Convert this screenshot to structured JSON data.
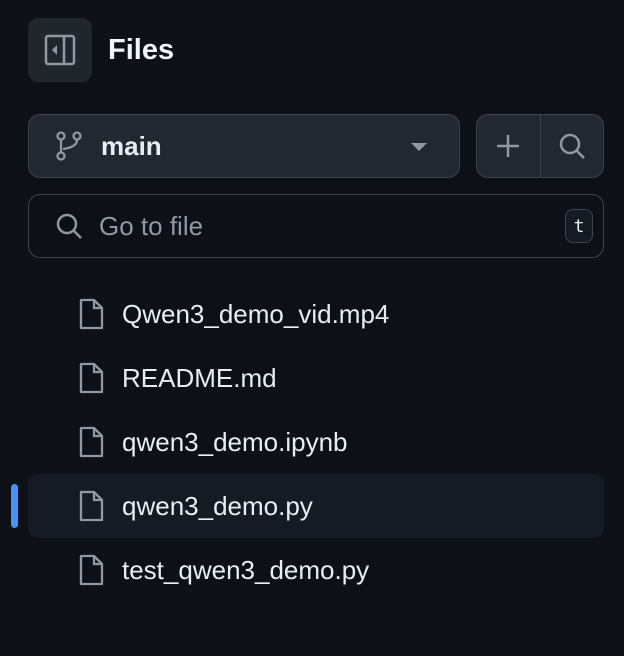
{
  "header": {
    "title": "Files",
    "toggle_icon": "sidebar-collapse-icon"
  },
  "branch": {
    "name": "main"
  },
  "search": {
    "placeholder": "Go to file",
    "shortcut": "t"
  },
  "files": [
    {
      "name": "Qwen3_demo_vid.mp4",
      "selected": false
    },
    {
      "name": "README.md",
      "selected": false
    },
    {
      "name": "qwen3_demo.ipynb",
      "selected": false
    },
    {
      "name": "qwen3_demo.py",
      "selected": true
    },
    {
      "name": "test_qwen3_demo.py",
      "selected": false
    }
  ],
  "colors": {
    "background": "#0d1117",
    "accent": "#4493f8"
  }
}
